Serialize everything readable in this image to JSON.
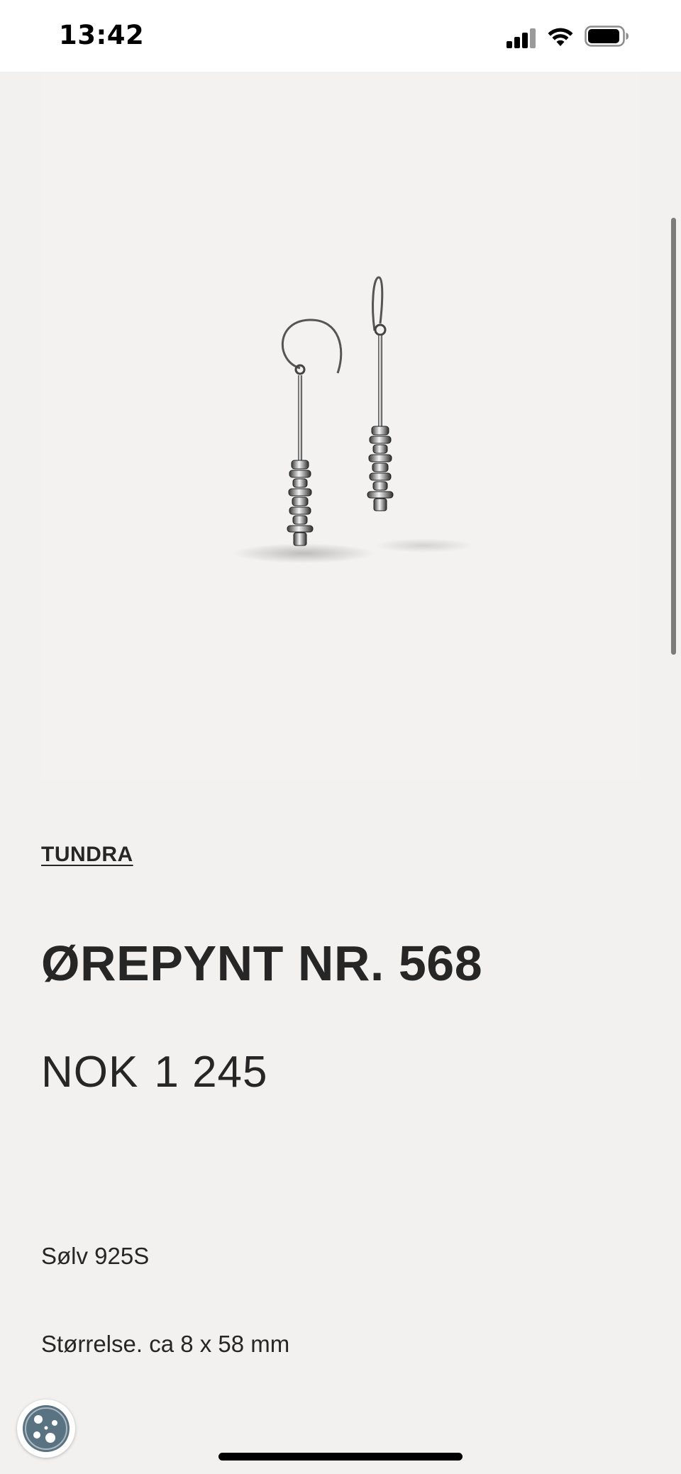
{
  "status_bar": {
    "time": "13:42",
    "icons": [
      "cellular-signal-icon",
      "wifi-icon",
      "battery-icon"
    ]
  },
  "product": {
    "image_alt": "earrings-product-image",
    "collection": "TUNDRA",
    "title": "ØREPYNT NR. 568",
    "price_currency": "NOK",
    "price_amount": "1 245",
    "details": {
      "material": "Sølv 925S",
      "size": "Størrelse. ca 8 x 58 mm"
    }
  },
  "cookie_button": {
    "icon": "cookie-icon"
  },
  "colors": {
    "page_background": "#f2f1ef",
    "text": "#262626"
  }
}
